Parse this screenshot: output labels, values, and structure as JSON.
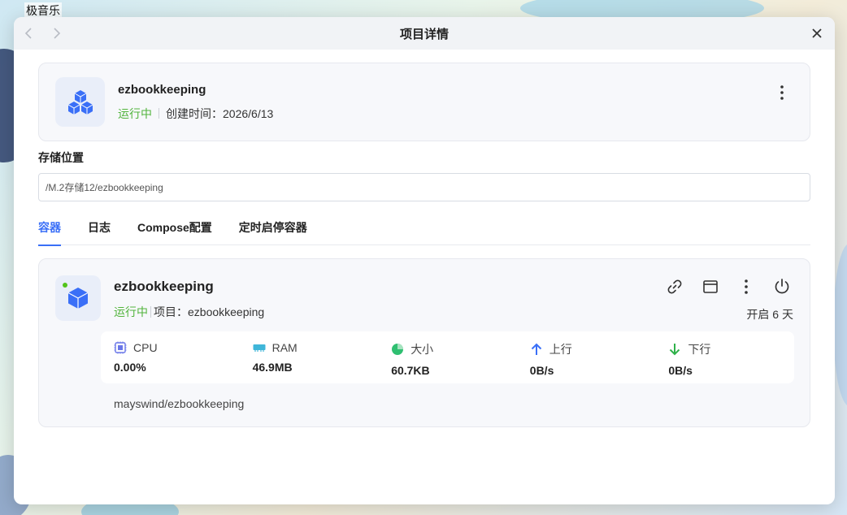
{
  "desktop": {
    "app_label": "极音乐"
  },
  "window": {
    "title": "项目详情"
  },
  "project": {
    "name": "ezbookkeeping",
    "status": "运行中",
    "created_label": "创建时间：",
    "created_date": "2026/6/13"
  },
  "storage": {
    "label": "存储位置",
    "path": "/M.2存储12/ezbookkeeping"
  },
  "tabs": [
    {
      "label": "容器",
      "active": true
    },
    {
      "label": "日志",
      "active": false
    },
    {
      "label": "Compose配置",
      "active": false
    },
    {
      "label": "定时启停容器",
      "active": false
    }
  ],
  "container": {
    "name": "ezbookkeeping",
    "status": "运行中",
    "project_label": "项目：",
    "project_name": "ezbookkeeping",
    "uptime": "开启 6 天",
    "image": "mayswind/ezbookkeeping",
    "stats": {
      "cpu": {
        "label": "CPU",
        "value": "0.00%"
      },
      "ram": {
        "label": "RAM",
        "value": "46.9MB"
      },
      "size": {
        "label": "大小",
        "value": "60.7KB"
      },
      "upload": {
        "label": "上行",
        "value": "0B/s"
      },
      "download": {
        "label": "下行",
        "value": "0B/s"
      }
    }
  },
  "colors": {
    "accent": "#3a6ff7",
    "running": "#52b43c"
  },
  "icons": [
    "chevron-left-icon",
    "chevron-right-icon",
    "close-icon",
    "cubes-icon",
    "kebab-icon",
    "cube-icon",
    "link-icon",
    "terminal-window-icon",
    "power-icon",
    "cpu-icon",
    "ram-icon",
    "pie-icon",
    "arrow-up-icon",
    "arrow-down-icon"
  ]
}
